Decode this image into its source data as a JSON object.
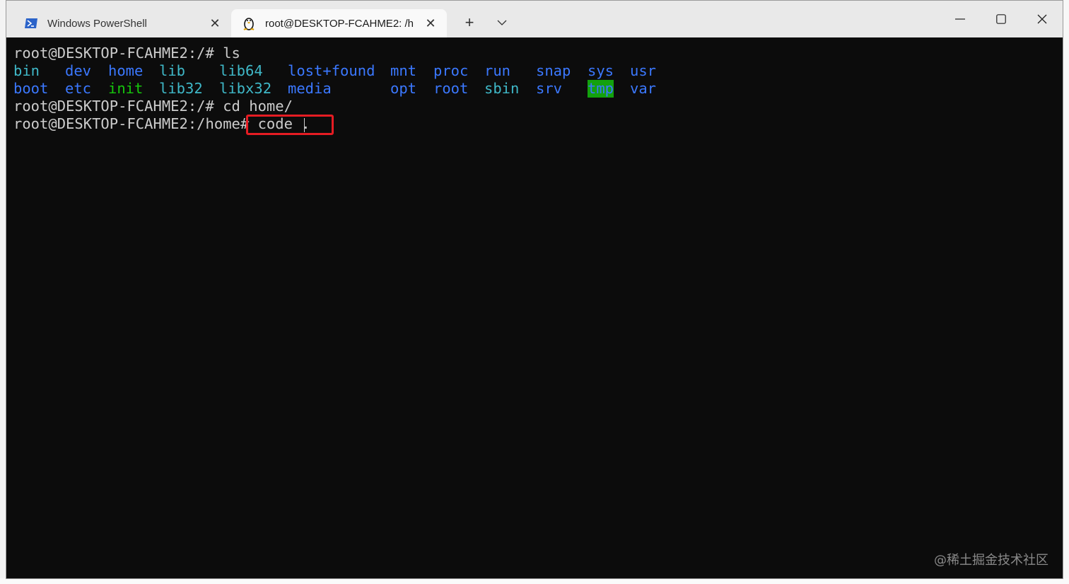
{
  "tabs": [
    {
      "label": "Windows PowerShell",
      "icon": "powershell-icon",
      "active": false
    },
    {
      "label": "root@DESKTOP-FCAHME2: /h",
      "icon": "linux-tux-icon",
      "active": true
    }
  ],
  "terminal": {
    "prompt_root": "root@DESKTOP-FCAHME2:/#",
    "prompt_home": "root@DESKTOP-FCAHME2:/home#",
    "cmd1": " ls",
    "cmd2": " cd home/",
    "cmd3": " code .",
    "ls_row1": [
      "bin",
      "dev",
      "home",
      "lib",
      "lib64",
      "lost+found",
      "mnt",
      "proc",
      "run",
      "snap",
      "sys",
      "usr"
    ],
    "ls_row2": [
      "boot",
      "etc",
      "init",
      "lib32",
      "libx32",
      "media",
      "opt",
      "root",
      "sbin",
      "srv",
      "tmp",
      "var"
    ]
  },
  "watermark": "@稀土掘金技术社区",
  "colors": {
    "dir": "#3b78ff",
    "symlink": "#3fb8c8",
    "exec": "#16c60c",
    "sticky_bg": "#13a10e",
    "highlight_border": "#e51c23",
    "terminal_bg": "#0c0c0c"
  }
}
